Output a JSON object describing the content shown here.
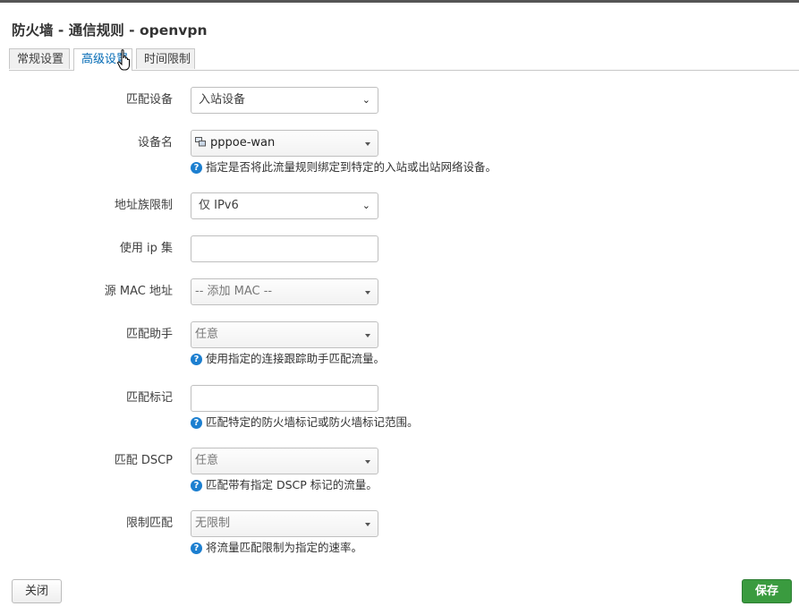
{
  "dialog": {
    "title": "防火墙 - 通信规则 - openvpn"
  },
  "tabs": [
    {
      "label": "常规设置",
      "active": false
    },
    {
      "label": "高级设置",
      "active": true
    },
    {
      "label": "时间限制",
      "active": false
    }
  ],
  "form": {
    "match_device": {
      "label": "匹配设备",
      "value": "入站设备"
    },
    "device_name": {
      "label": "设备名",
      "value": "pppoe-wan",
      "hint": "指定是否将此流量规则绑定到特定的入站或出站网络设备。",
      "icon": "network-device-icon"
    },
    "address_family": {
      "label": "地址族限制",
      "value": "仅 IPv6"
    },
    "use_ipset": {
      "label": "使用 ip 集",
      "value": ""
    },
    "src_mac": {
      "label": "源 MAC 地址",
      "placeholder": "-- 添加 MAC --"
    },
    "helper": {
      "label": "匹配助手",
      "value": "任意",
      "hint": "使用指定的连接跟踪助手匹配流量。"
    },
    "mark": {
      "label": "匹配标记",
      "value": "",
      "hint": "匹配特定的防火墙标记或防火墙标记范围。"
    },
    "dscp": {
      "label": "匹配 DSCP",
      "value": "任意",
      "hint": "匹配带有指定 DSCP 标记的流量。"
    },
    "limit": {
      "label": "限制匹配",
      "value": "无限制",
      "hint": "将流量匹配限制为指定的速率。"
    }
  },
  "buttons": {
    "close": "关闭",
    "save": "保存"
  },
  "colors": {
    "accent": "#0069b4",
    "save": "#3a9b3f",
    "help_icon": "#1c7fd0"
  }
}
